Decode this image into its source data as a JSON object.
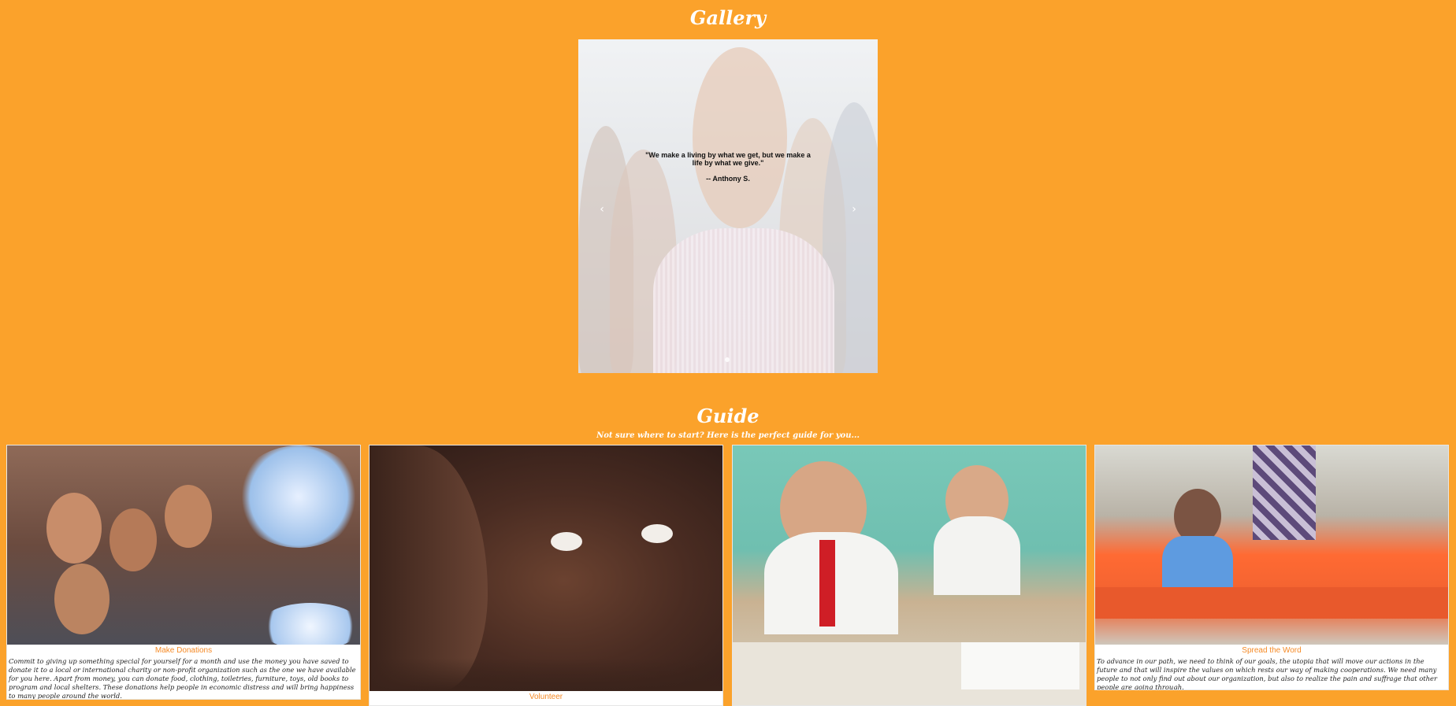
{
  "gallery": {
    "title": "Gallery",
    "slide": {
      "quote": "\"We make a living by what we get, but we make a life by what we give.\"",
      "author": "-- Anthony S.",
      "prev_glyph": "‹",
      "next_glyph": "›"
    }
  },
  "guide": {
    "title": "Guide",
    "subtitle": "Not sure where to start? Here is the perfect guide for you...",
    "cards": [
      {
        "caption": "Make Donations",
        "description": "Commit to giving up something special for yourself for a month and use the money you have saved to donate it to a local or international charity or non-profit organization such as the one we have available for you here. Apart from money, you can donate food, clothing, toiletries, furniture, toys, old books to program and local shelters. These donations help people in economic distress and will bring happiness to many people around the world."
      },
      {
        "caption": "Volunteer",
        "description": ""
      },
      {
        "caption": "",
        "description": ""
      },
      {
        "caption": "Spread the Word",
        "description": "To advance in our path, we need to think of our goals, the utopia that will move our actions in the future and that will inspire the values on which rests our way of making cooperations. We need many people to not only find out about our organization, but also to realize the pain and suffrage that other people are going through."
      }
    ]
  },
  "colors": {
    "background": "#FBA22B",
    "caption": "#F58A26",
    "card": "#FFFFFF"
  }
}
